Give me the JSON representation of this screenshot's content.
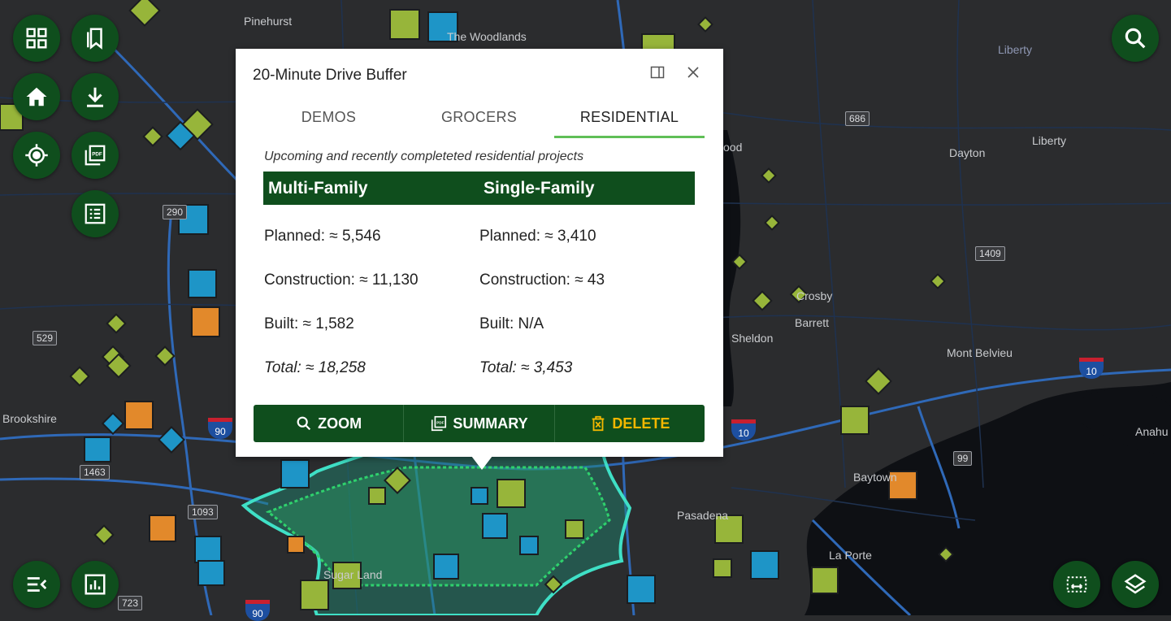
{
  "map": {
    "labels": [
      "Pinehurst",
      "The Woodlands",
      "Liberty",
      "Dayton",
      "Liberty",
      "Crosby",
      "Barrett",
      "Sheldon",
      "Mont Belvieu",
      "Baytown",
      "Pasadena",
      "La Porte",
      "Sugar Land",
      "Brookshire",
      "Anahu",
      "ood"
    ],
    "shields": [
      "686",
      "1409",
      "529",
      "1463",
      "1093",
      "723",
      "99",
      "290"
    ],
    "interstates": [
      "10",
      "10",
      "90",
      "90"
    ]
  },
  "popup": {
    "title": "20-Minute Drive Buffer",
    "tabs": [
      "DEMOS",
      "GROCERS",
      "RESIDENTIAL"
    ],
    "active_tab": "RESIDENTIAL",
    "subtitle": "Upcoming and recently completeted residential projects",
    "columns": {
      "multi": {
        "header": "Multi-Family",
        "planned": "Planned: ≈ 5,546",
        "construction": "Construction: ≈ 11,130",
        "built": "Built: ≈ 1,582",
        "total": "Total: ≈ 18,258"
      },
      "single": {
        "header": "Single-Family",
        "planned": "Planned: ≈ 3,410",
        "construction": "Construction: ≈ 43",
        "built": "Built: N/A",
        "total": "Total: ≈ 3,453"
      }
    },
    "actions": {
      "zoom": "ZOOM",
      "summary": "SUMMARY",
      "delete": "DELETE"
    }
  },
  "toolbar_icons": [
    "qr-grid-icon",
    "bookmarks-icon",
    "home-icon",
    "download-icon",
    "locate-icon",
    "pdf-icon",
    "list-icon",
    "collapse-menu-icon",
    "chart-icon",
    "search-icon",
    "measure-icon",
    "layers-icon"
  ],
  "colors": {
    "button_green": "#0f4e1d",
    "tab_underline": "#5fbf57",
    "delete_text": "#f2b700",
    "buffer_fill": "#1f8a74",
    "buffer_edge": "#3fe0c6"
  }
}
